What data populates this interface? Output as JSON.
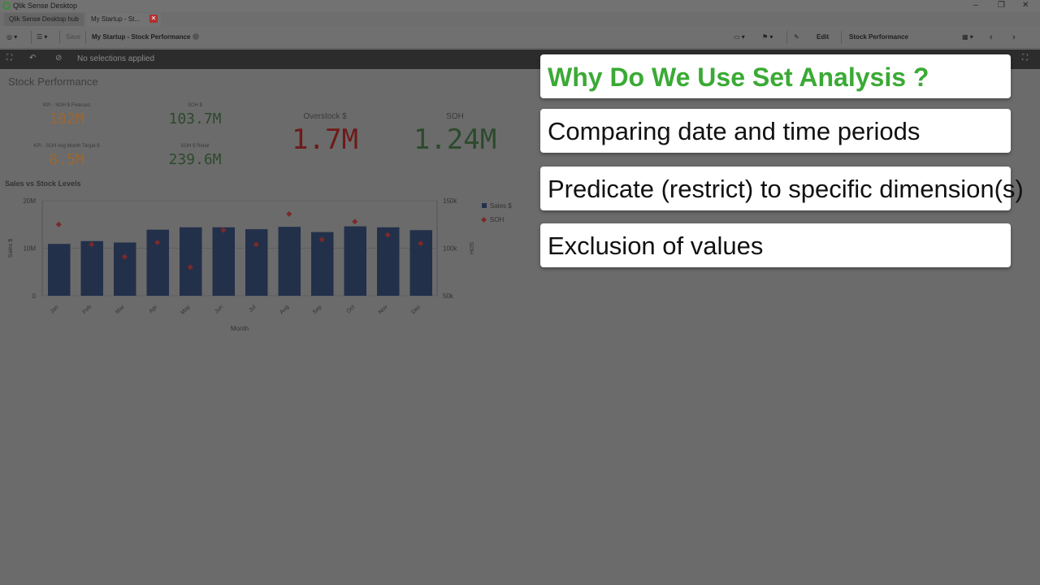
{
  "window": {
    "title": "Qlik Sense Desktop"
  },
  "tabs": [
    {
      "label": "Qlik Sense Desktop hub"
    },
    {
      "label": "My Startup - St..."
    }
  ],
  "toolbar": {
    "save_label": "Save",
    "app_title": "My Startup - Stock Performance",
    "edit_label": "Edit",
    "sheet_name": "Stock Performance"
  },
  "selections": {
    "status": "No selections applied"
  },
  "sheet": {
    "title": "Stock Performance",
    "kpis": [
      {
        "label": "KPI - SOH $ Forecast",
        "value": "102M"
      },
      {
        "label": "SOH $",
        "value": "103.7M"
      },
      {
        "label": "Overstock $",
        "value": "1.7M"
      },
      {
        "label": "SOH",
        "value": "1.24M"
      },
      {
        "label": "KPI - SOH Avg Month Target $",
        "value": "8.5M"
      },
      {
        "label": "SOH $ Retail",
        "value": "239.6M"
      }
    ]
  },
  "colors": {
    "bar": "#22304a",
    "soh_marker": "#7a2a2a",
    "accent_green": "#3aaa35"
  },
  "chart_data": {
    "type": "bar",
    "title": "Sales vs Stock Levels",
    "categories": [
      "Jan",
      "Feb",
      "Mar",
      "Apr",
      "May",
      "Jun",
      "Jul",
      "Aug",
      "Sep",
      "Oct",
      "Nov",
      "Dec"
    ],
    "series": [
      {
        "name": "Sales $",
        "type": "bar",
        "axis": "left",
        "values": [
          10.9,
          11.5,
          11.2,
          13.9,
          14.4,
          14.4,
          14.0,
          14.5,
          13.4,
          14.6,
          14.4,
          13.8
        ]
      },
      {
        "name": "SOH",
        "type": "scatter",
        "axis": "right",
        "values": [
          125,
          104,
          91,
          106,
          80,
          119,
          104,
          136,
          109,
          128,
          114,
          105
        ]
      }
    ],
    "xlabel": "Month",
    "ylabel": "Sales $",
    "y2label": "SOH",
    "ylim": [
      0,
      20
    ],
    "y2lim": [
      50,
      150
    ],
    "yticks": [
      "0",
      "10M",
      "20M"
    ],
    "y2ticks": [
      "50k",
      "100k",
      "150k"
    ],
    "legend": "right",
    "grid": true
  },
  "overlay": {
    "heading": "Why Do We Use Set Analysis ?",
    "points": [
      "Comparing date and time periods",
      "Predicate (restrict) to specific dimension(s)",
      "Exclusion of values"
    ]
  }
}
